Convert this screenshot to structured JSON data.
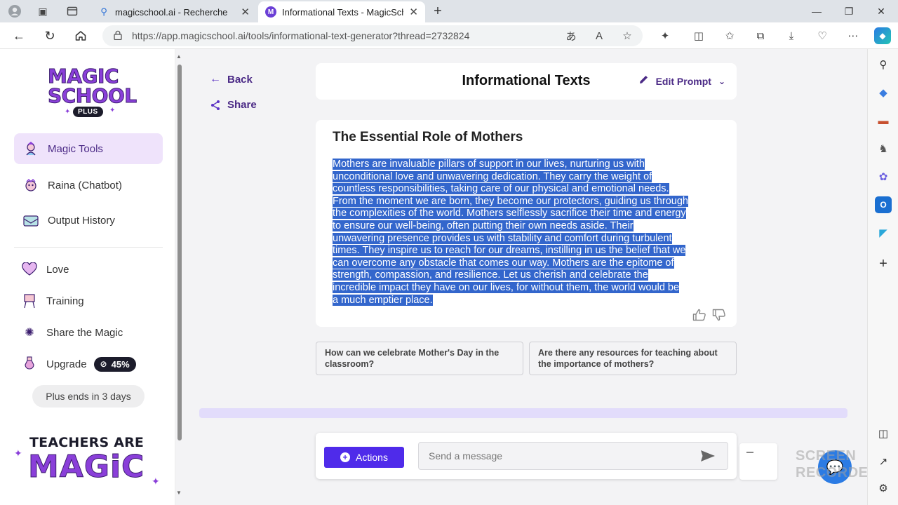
{
  "browser": {
    "tabs": [
      {
        "title": "magicschool.ai - Recherche",
        "favicon": "search-favicon",
        "active": false
      },
      {
        "title": "Informational Texts - MagicScho",
        "favicon": "magicschool-favicon",
        "active": true
      }
    ],
    "url": "https://app.magicschool.ai/tools/informational-text-generator?thread=2732824",
    "new_tab_label": "+"
  },
  "sidebar": {
    "logo": {
      "line1": "MAGIC",
      "line2": "SCHOOL",
      "badge": "PLUS"
    },
    "primary_items": [
      {
        "label": "Magic Tools",
        "icon": "magic-tools-icon",
        "active": true
      },
      {
        "label": "Raina (Chatbot)",
        "icon": "chatbot-icon",
        "active": false
      },
      {
        "label": "Output History",
        "icon": "history-icon",
        "active": false
      }
    ],
    "secondary_items": [
      {
        "label": "Love",
        "icon": "heart-icon"
      },
      {
        "label": "Training",
        "icon": "easel-icon"
      },
      {
        "label": "Share the Magic",
        "icon": "sparkle-icon"
      },
      {
        "label": "Upgrade",
        "icon": "potion-icon"
      }
    ],
    "upgrade_badge": "45%",
    "plus_ends": "Plus ends in 3 days",
    "footer": {
      "line1": "TEACHERS ARE",
      "line2": "MAGiC"
    }
  },
  "nav": {
    "back_label": "Back",
    "share_label": "Share"
  },
  "header": {
    "title": "Informational Texts",
    "edit_prompt_label": "Edit Prompt"
  },
  "output": {
    "heading": "The Essential Role of Mothers",
    "lines": [
      "Mothers are invaluable pillars of support in our lives, nurturing us with",
      "unconditional love and unwavering dedication. They carry the weight of",
      "countless responsibilities, taking care of our physical and emotional needs.",
      "From the moment we are born, they become our protectors, guiding us through",
      "the complexities of the world. Mothers selflessly sacrifice their time and energy",
      "to ensure our well-being, often putting their own needs aside. Their",
      "unwavering presence provides us with stability and comfort during turbulent",
      "times. They inspire us to reach for our dreams, instilling in us the belief that we",
      "can overcome any obstacle that comes our way. Mothers are the epitome of",
      "strength, compassion, and resilience. Let us cherish and celebrate the",
      "incredible impact they have on our lives, for without them, the world would be",
      "a much emptier place."
    ],
    "selection_color": "#3366cc"
  },
  "suggestions": [
    "How can we celebrate Mother's Day in the classroom?",
    "Are there any resources for teaching about the importance of mothers?"
  ],
  "composer": {
    "actions_label": "Actions",
    "message_placeholder": "Send a message"
  },
  "watermark": {
    "line1": "SCREEN",
    "line2": "RECORDER"
  },
  "colors": {
    "brand_purple": "#8a3fd9",
    "accent_indigo": "#4f2bea",
    "active_nav_bg": "#efe3fb",
    "link_purple": "#4b2a86"
  }
}
